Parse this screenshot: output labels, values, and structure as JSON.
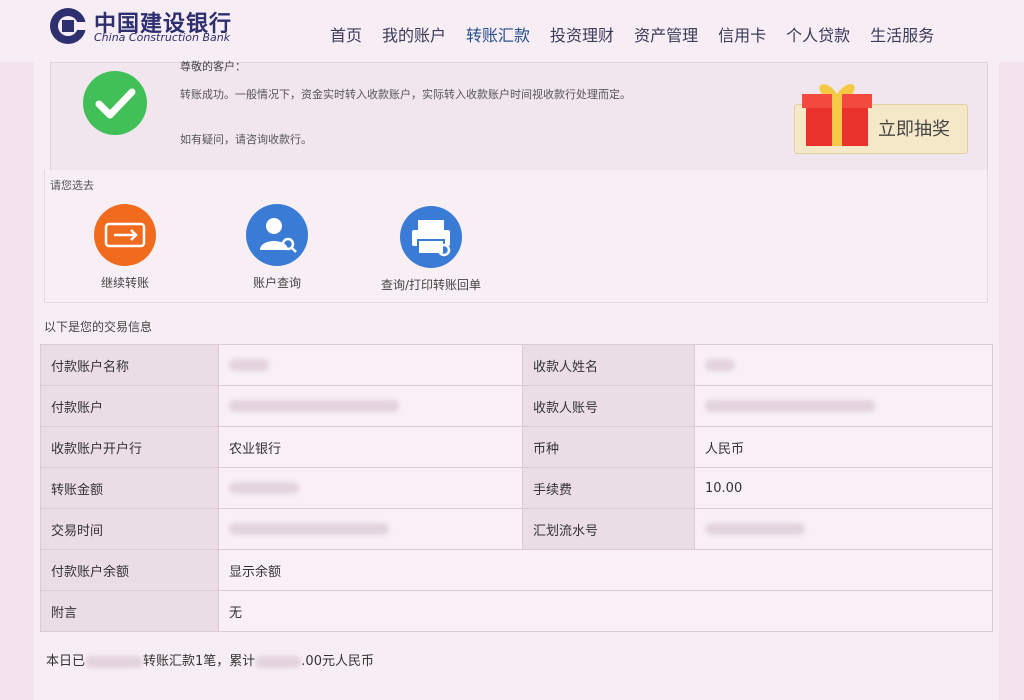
{
  "brand": {
    "name_cn": "中国建设银行",
    "name_en": "China Construction Bank"
  },
  "nav": [
    {
      "label": "首页"
    },
    {
      "label": "我的账户"
    },
    {
      "label": "转账汇款"
    },
    {
      "label": "投资理财"
    },
    {
      "label": "资产管理"
    },
    {
      "label": "信用卡"
    },
    {
      "label": "个人贷款"
    },
    {
      "label": "生活服务"
    }
  ],
  "success": {
    "greeting": "尊敬的客户：",
    "message": "转账成功。一般情况下，资金实时转入收款账户，实际转入收款账户时间视收款行处理而定。",
    "contact": "如有疑问，请咨询收款行。"
  },
  "lottery": {
    "label": "立即抽奖"
  },
  "goto": {
    "title": "请您选去",
    "actions": [
      {
        "label": "继续转账",
        "icon": "transfer-icon",
        "color": "#f06b1e"
      },
      {
        "label": "账户查询",
        "icon": "user-search-icon",
        "color": "#3a7bd5"
      },
      {
        "label": "查询/打印转账回单",
        "icon": "printer-icon",
        "color": "#3a7bd5"
      }
    ]
  },
  "info": {
    "title": "以下是您的交易信息",
    "rows": [
      {
        "l1": "付款账户名称",
        "v1": "",
        "l2": "收款人姓名",
        "v2": ""
      },
      {
        "l1": "付款账户",
        "v1": "",
        "l2": "收款人账号",
        "v2": ""
      },
      {
        "l1": "收款账户开户行",
        "v1": "农业银行",
        "l2": "币种",
        "v2": "人民币"
      },
      {
        "l1": "转账金额",
        "v1": "",
        "l2": "手续费",
        "v2": "10.00"
      },
      {
        "l1": "交易时间",
        "v1": "",
        "l2": "汇划流水号",
        "v2": ""
      }
    ],
    "balance_label": "付款账户余额",
    "balance_value": "显示余额",
    "note_label": "附言",
    "note_value": "无"
  },
  "footer": {
    "part1": "本日已",
    "part2": "转账汇款1笔，累计",
    "part3": ".00元人民币"
  },
  "colors": {
    "brand": "#2e2f6f",
    "success": "#40c057",
    "orange": "#f06b1e",
    "blue": "#3a7bd5"
  }
}
